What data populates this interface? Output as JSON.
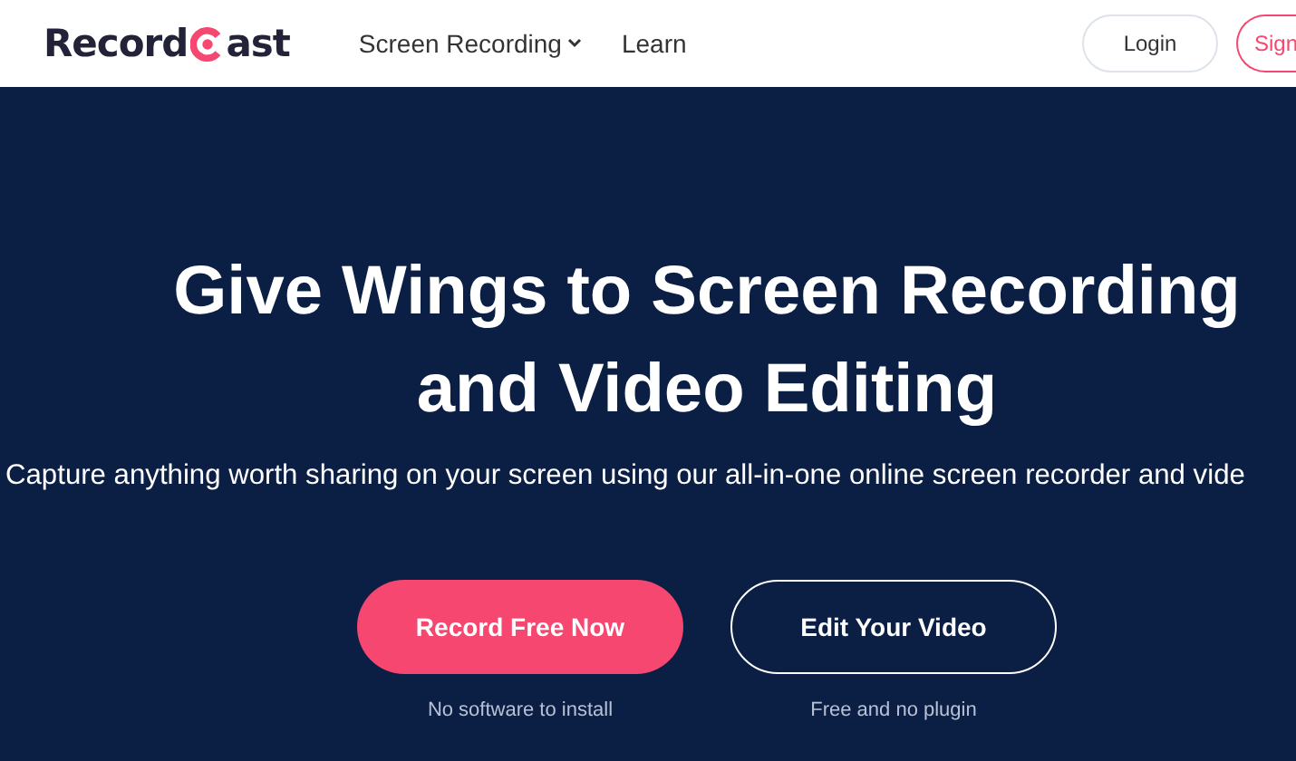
{
  "header": {
    "logo": {
      "before": "Record",
      "after": "ast"
    },
    "nav": [
      {
        "label": "Screen Recording",
        "kind": "dropdown"
      },
      {
        "label": "Learn",
        "kind": "link"
      }
    ],
    "buttons": [
      {
        "label": "Login",
        "kind": "outline"
      },
      {
        "label": "Sign",
        "kind": "accent"
      }
    ]
  },
  "hero": {
    "title_lines": [
      "Give Wings to Screen Recording",
      "and Video Editing"
    ],
    "subtitle": "Capture anything worth sharing on your screen using our all-in-one online screen recorder and vide",
    "actions": [
      {
        "label": "Record Free Now",
        "kind": "primary",
        "note": "No software to install"
      },
      {
        "label": "Edit Your Video",
        "kind": "outline",
        "note": "Free and no plugin"
      }
    ]
  }
}
